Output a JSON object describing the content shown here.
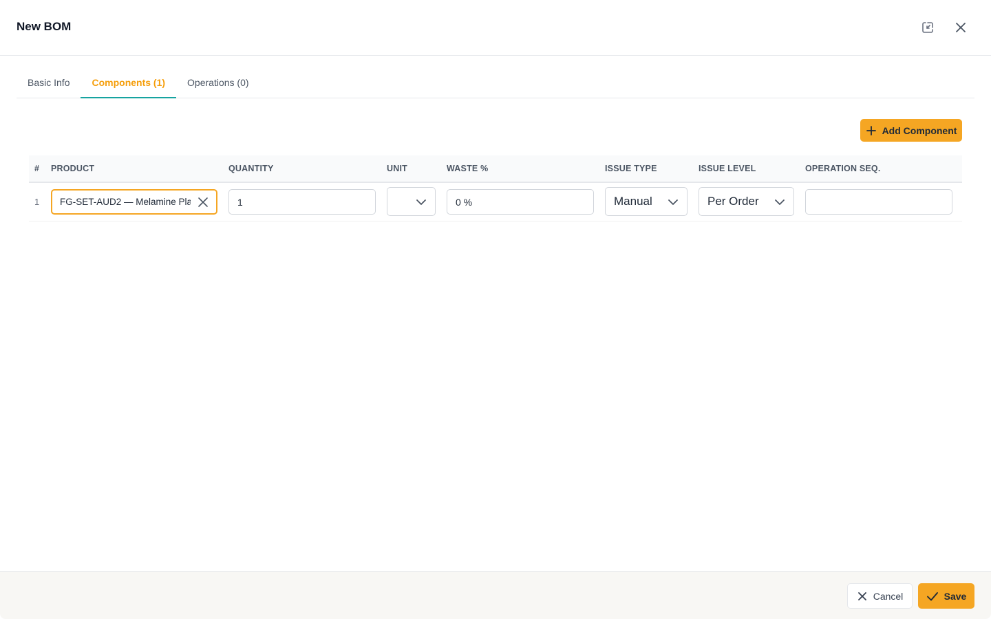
{
  "dialog": {
    "title": "New BOM"
  },
  "tabs": [
    {
      "label": "Basic Info",
      "active": false
    },
    {
      "label": "Components (1)",
      "active": true
    },
    {
      "label": "Operations (0)",
      "active": false
    }
  ],
  "toolbar": {
    "add_label": "Add Component"
  },
  "table": {
    "columns": [
      "#",
      "PRODUCT",
      "QUANTITY",
      "UNIT",
      "WASTE %",
      "ISSUE TYPE",
      "ISSUE LEVEL",
      "OPERATION SEQ."
    ],
    "rows": [
      {
        "num": "1",
        "product": "FG-SET-AUD2 — Melamine Pla",
        "quantity": "1",
        "unit": "",
        "waste": "0 %",
        "issue_type": "Manual",
        "issue_level": "Per Order",
        "operation_seq": ""
      }
    ]
  },
  "footer": {
    "cancel_label": "Cancel",
    "save_label": "Save"
  },
  "colors": {
    "accent": "#f5a623",
    "tab_active_text": "#f59e0b",
    "tab_underline": "#16a3a0"
  },
  "icons": {
    "minimize": "minimize-window-icon",
    "close": "close-icon",
    "add": "plus-icon",
    "clear": "clear-icon",
    "dropdown": "chevron-down-icon",
    "cancel": "x-icon",
    "save": "check-icon"
  }
}
